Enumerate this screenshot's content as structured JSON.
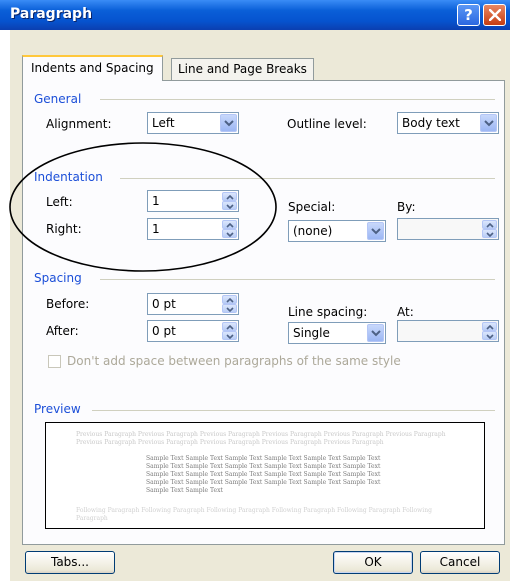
{
  "dialog": {
    "title": "Paragraph",
    "help_glyph": "?",
    "close_icon": "close-icon"
  },
  "tabs": [
    {
      "label": "Indents and Spacing",
      "active": true
    },
    {
      "label": "Line and Page Breaks",
      "active": false
    }
  ],
  "general": {
    "header": "General",
    "alignment_label": "Alignment:",
    "alignment_value": "Left",
    "outline_label": "Outline level:",
    "outline_value": "Body text"
  },
  "indentation": {
    "header": "Indentation",
    "left_label": "Left:",
    "left_value": "1",
    "right_label": "Right:",
    "right_value": "1",
    "special_label": "Special:",
    "special_value": "(none)",
    "by_label": "By:",
    "by_value": ""
  },
  "spacing": {
    "header": "Spacing",
    "before_label": "Before:",
    "before_value": "0 pt",
    "after_label": "After:",
    "after_value": "0 pt",
    "line_spacing_label": "Line spacing:",
    "line_spacing_value": "Single",
    "at_label": "At:",
    "at_value": "",
    "no_space_checkbox_label": "Don't add space between paragraphs of the same style",
    "no_space_checked": false
  },
  "preview": {
    "header": "Preview",
    "previous_text": "Previous Paragraph Previous Paragraph Previous Paragraph Previous Paragraph Previous Paragraph Previous Paragraph Previous Paragraph Previous Paragraph Previous Paragraph Previous Paragraph Previous Paragraph",
    "sample_text": "Sample Text Sample Text Sample Text Sample Text Sample Text Sample Text Sample Text Sample Text Sample Text Sample Text Sample Text Sample Text Sample Text Sample Text Sample Text Sample Text Sample Text Sample Text Sample Text Sample Text Sample Text Sample Text Sample Text Sample Text Sample Text Sample Text",
    "following_text": "Following Paragraph Following Paragraph Following Paragraph Following Paragraph Following Paragraph Following Paragraph"
  },
  "buttons": {
    "tabs": "Tabs...",
    "ok": "OK",
    "cancel": "Cancel"
  },
  "colors": {
    "titlebar": "#0653cf",
    "group_header": "#1c4fd8",
    "annotation": "#000000"
  }
}
